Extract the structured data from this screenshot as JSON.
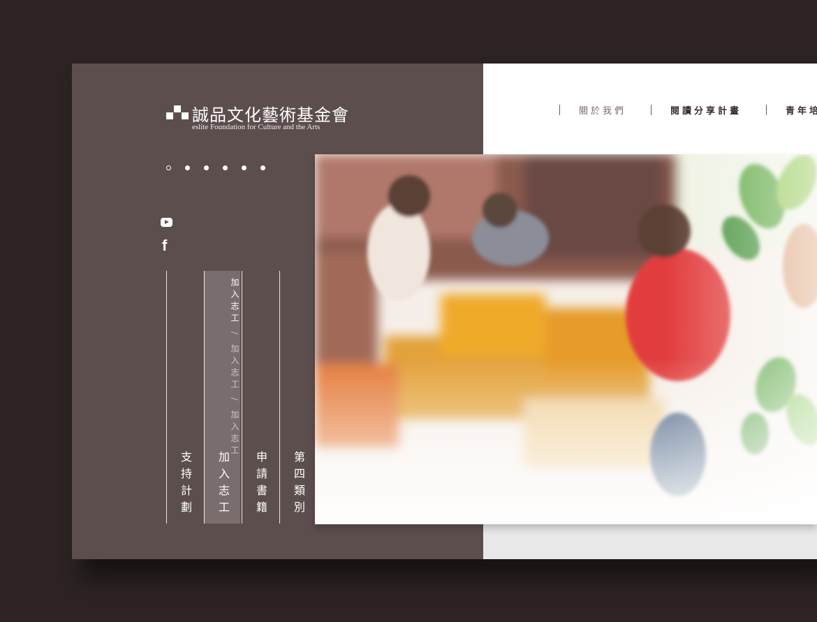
{
  "logo": {
    "name_cn": "誠品文化藝術基金會",
    "name_en": "eslite Foundation for Culture and the Arts"
  },
  "slider": {
    "dot_count": 6,
    "active_index": 0
  },
  "social": {
    "icons": [
      "youtube-icon",
      "facebook-icon"
    ]
  },
  "nav": {
    "items": [
      "關於我們",
      "閱讀分享計畫",
      "青年培"
    ]
  },
  "menu": {
    "columns": [
      {
        "label": "支持計劃"
      },
      {
        "label": "加入志工",
        "active": true,
        "sub": [
          "加入志工",
          "/",
          "加入志工",
          "/",
          "加入志工"
        ]
      },
      {
        "label": "申請書籍"
      },
      {
        "label": "第四類別"
      }
    ]
  },
  "hero": {
    "description_icon": "watercolor-volunteers-image"
  },
  "colors": {
    "page_bg": "#2c2322",
    "panel": "#5d4e4e",
    "active_column": "#7a6d6d",
    "nav_text": "#3a2f2f"
  }
}
